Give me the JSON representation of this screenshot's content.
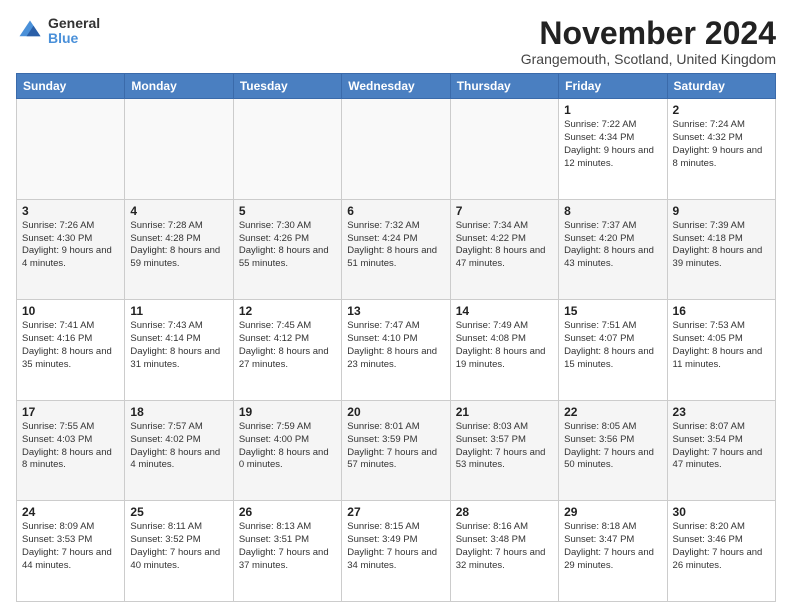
{
  "logo": {
    "general": "General",
    "blue": "Blue"
  },
  "header": {
    "month": "November 2024",
    "location": "Grangemouth, Scotland, United Kingdom"
  },
  "days_of_week": [
    "Sunday",
    "Monday",
    "Tuesday",
    "Wednesday",
    "Thursday",
    "Friday",
    "Saturday"
  ],
  "weeks": [
    [
      {
        "day": "",
        "info": ""
      },
      {
        "day": "",
        "info": ""
      },
      {
        "day": "",
        "info": ""
      },
      {
        "day": "",
        "info": ""
      },
      {
        "day": "",
        "info": ""
      },
      {
        "day": "1",
        "info": "Sunrise: 7:22 AM\nSunset: 4:34 PM\nDaylight: 9 hours and 12 minutes."
      },
      {
        "day": "2",
        "info": "Sunrise: 7:24 AM\nSunset: 4:32 PM\nDaylight: 9 hours and 8 minutes."
      }
    ],
    [
      {
        "day": "3",
        "info": "Sunrise: 7:26 AM\nSunset: 4:30 PM\nDaylight: 9 hours and 4 minutes."
      },
      {
        "day": "4",
        "info": "Sunrise: 7:28 AM\nSunset: 4:28 PM\nDaylight: 8 hours and 59 minutes."
      },
      {
        "day": "5",
        "info": "Sunrise: 7:30 AM\nSunset: 4:26 PM\nDaylight: 8 hours and 55 minutes."
      },
      {
        "day": "6",
        "info": "Sunrise: 7:32 AM\nSunset: 4:24 PM\nDaylight: 8 hours and 51 minutes."
      },
      {
        "day": "7",
        "info": "Sunrise: 7:34 AM\nSunset: 4:22 PM\nDaylight: 8 hours and 47 minutes."
      },
      {
        "day": "8",
        "info": "Sunrise: 7:37 AM\nSunset: 4:20 PM\nDaylight: 8 hours and 43 minutes."
      },
      {
        "day": "9",
        "info": "Sunrise: 7:39 AM\nSunset: 4:18 PM\nDaylight: 8 hours and 39 minutes."
      }
    ],
    [
      {
        "day": "10",
        "info": "Sunrise: 7:41 AM\nSunset: 4:16 PM\nDaylight: 8 hours and 35 minutes."
      },
      {
        "day": "11",
        "info": "Sunrise: 7:43 AM\nSunset: 4:14 PM\nDaylight: 8 hours and 31 minutes."
      },
      {
        "day": "12",
        "info": "Sunrise: 7:45 AM\nSunset: 4:12 PM\nDaylight: 8 hours and 27 minutes."
      },
      {
        "day": "13",
        "info": "Sunrise: 7:47 AM\nSunset: 4:10 PM\nDaylight: 8 hours and 23 minutes."
      },
      {
        "day": "14",
        "info": "Sunrise: 7:49 AM\nSunset: 4:08 PM\nDaylight: 8 hours and 19 minutes."
      },
      {
        "day": "15",
        "info": "Sunrise: 7:51 AM\nSunset: 4:07 PM\nDaylight: 8 hours and 15 minutes."
      },
      {
        "day": "16",
        "info": "Sunrise: 7:53 AM\nSunset: 4:05 PM\nDaylight: 8 hours and 11 minutes."
      }
    ],
    [
      {
        "day": "17",
        "info": "Sunrise: 7:55 AM\nSunset: 4:03 PM\nDaylight: 8 hours and 8 minutes."
      },
      {
        "day": "18",
        "info": "Sunrise: 7:57 AM\nSunset: 4:02 PM\nDaylight: 8 hours and 4 minutes."
      },
      {
        "day": "19",
        "info": "Sunrise: 7:59 AM\nSunset: 4:00 PM\nDaylight: 8 hours and 0 minutes."
      },
      {
        "day": "20",
        "info": "Sunrise: 8:01 AM\nSunset: 3:59 PM\nDaylight: 7 hours and 57 minutes."
      },
      {
        "day": "21",
        "info": "Sunrise: 8:03 AM\nSunset: 3:57 PM\nDaylight: 7 hours and 53 minutes."
      },
      {
        "day": "22",
        "info": "Sunrise: 8:05 AM\nSunset: 3:56 PM\nDaylight: 7 hours and 50 minutes."
      },
      {
        "day": "23",
        "info": "Sunrise: 8:07 AM\nSunset: 3:54 PM\nDaylight: 7 hours and 47 minutes."
      }
    ],
    [
      {
        "day": "24",
        "info": "Sunrise: 8:09 AM\nSunset: 3:53 PM\nDaylight: 7 hours and 44 minutes."
      },
      {
        "day": "25",
        "info": "Sunrise: 8:11 AM\nSunset: 3:52 PM\nDaylight: 7 hours and 40 minutes."
      },
      {
        "day": "26",
        "info": "Sunrise: 8:13 AM\nSunset: 3:51 PM\nDaylight: 7 hours and 37 minutes."
      },
      {
        "day": "27",
        "info": "Sunrise: 8:15 AM\nSunset: 3:49 PM\nDaylight: 7 hours and 34 minutes."
      },
      {
        "day": "28",
        "info": "Sunrise: 8:16 AM\nSunset: 3:48 PM\nDaylight: 7 hours and 32 minutes."
      },
      {
        "day": "29",
        "info": "Sunrise: 8:18 AM\nSunset: 3:47 PM\nDaylight: 7 hours and 29 minutes."
      },
      {
        "day": "30",
        "info": "Sunrise: 8:20 AM\nSunset: 3:46 PM\nDaylight: 7 hours and 26 minutes."
      }
    ]
  ]
}
